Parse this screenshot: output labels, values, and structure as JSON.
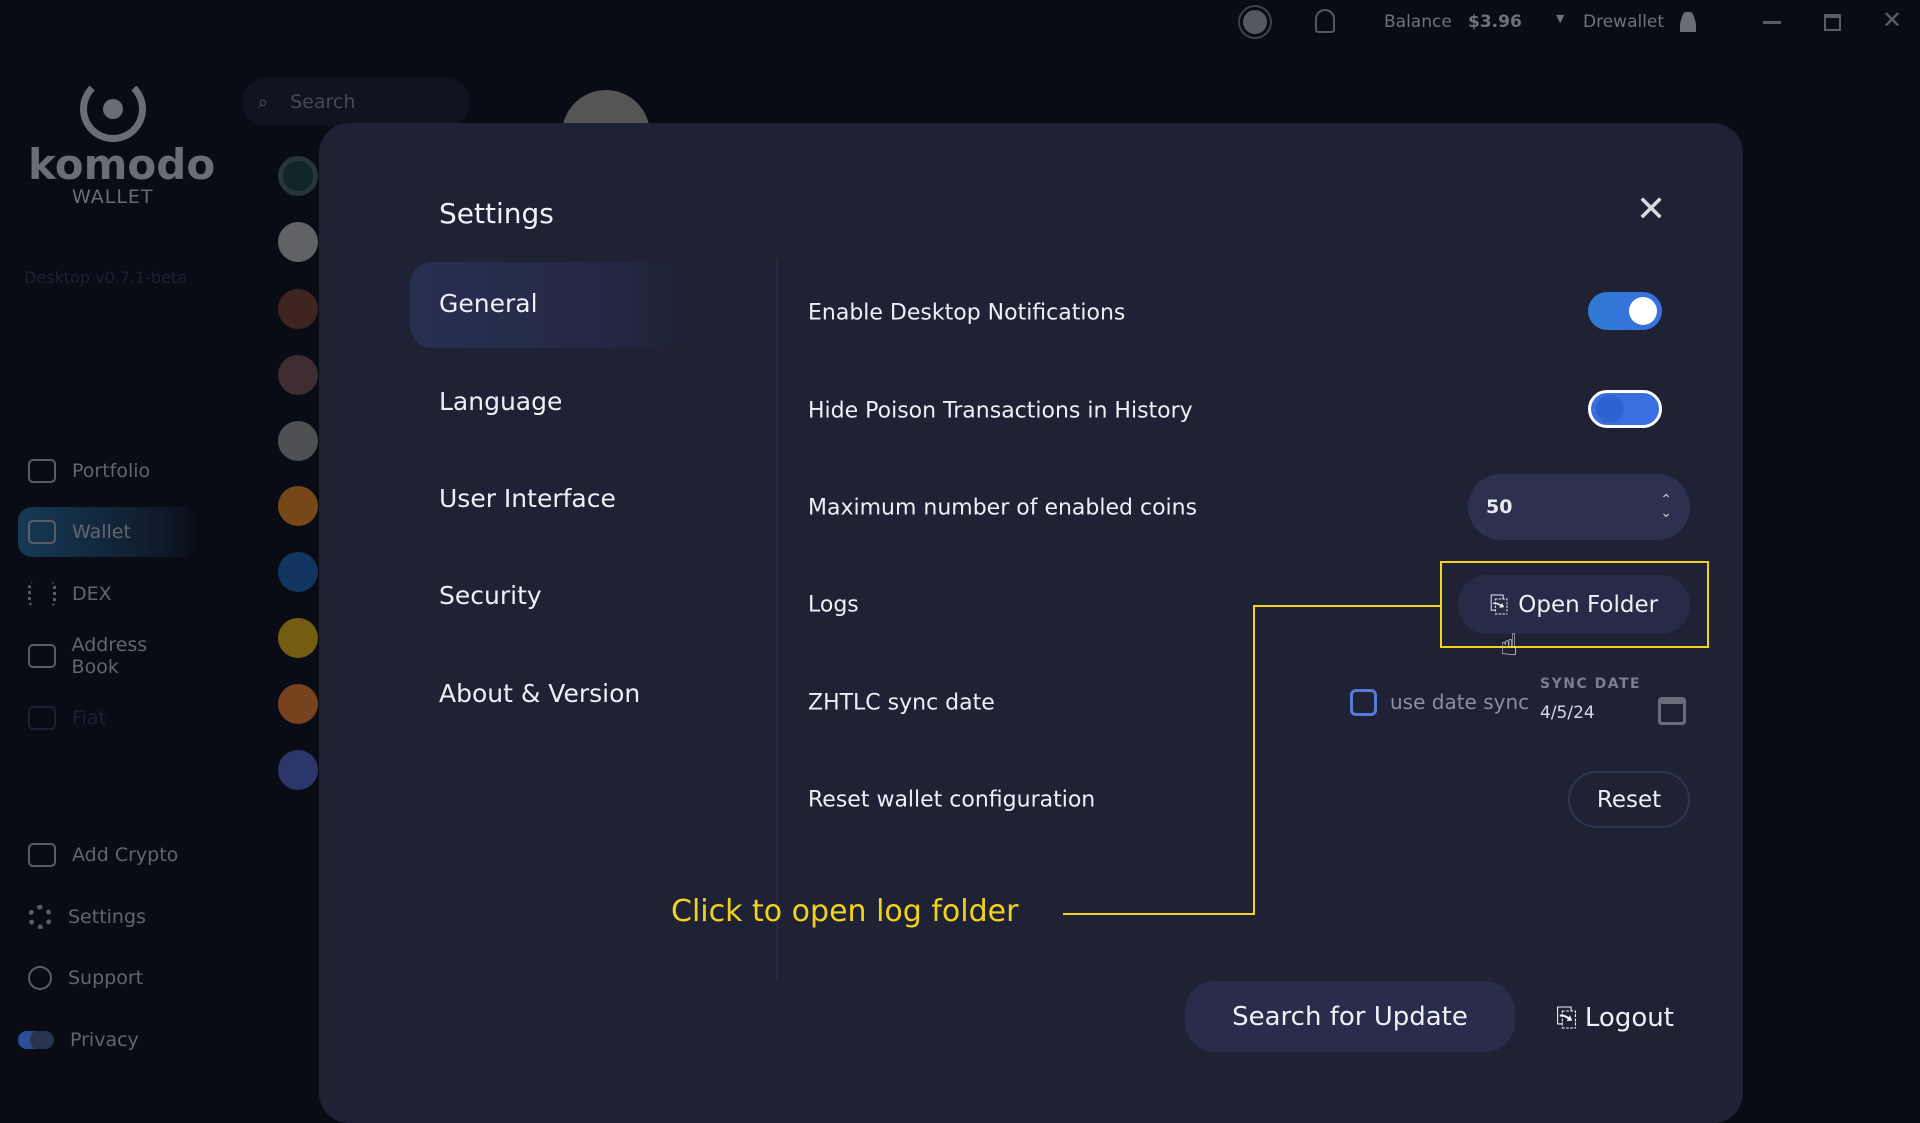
{
  "topbar": {
    "balance_label": "Balance",
    "balance_value": "$3.96",
    "account": "Drewallet",
    "icons": [
      "sun-icon",
      "bell-icon",
      "user-icon",
      "minimize-icon",
      "maximize-icon",
      "close-icon"
    ]
  },
  "sidebar": {
    "logo_text": "komodo",
    "logo_sub": "WALLET",
    "version": "Desktop v0.7.1-beta",
    "search_placeholder": "Search",
    "items": [
      {
        "label": "Portfolio"
      },
      {
        "label": "Wallet",
        "active": true
      },
      {
        "label": "DEX"
      },
      {
        "label": "Address Book"
      },
      {
        "label": "Fiat"
      }
    ],
    "bottom": [
      {
        "label": "Add Crypto"
      },
      {
        "label": "Settings"
      },
      {
        "label": "Support"
      },
      {
        "label": "Privacy"
      }
    ]
  },
  "coins": [
    "komodo",
    "panda",
    "avatar-1",
    "avatar-2",
    "litecoin",
    "bitcoin",
    "digibyte",
    "yellow-coin",
    "shiba",
    "ethereum"
  ],
  "settings": {
    "title": "Settings",
    "nav": [
      {
        "label": "General",
        "active": true
      },
      {
        "label": "Language"
      },
      {
        "label": "User Interface"
      },
      {
        "label": "Security"
      },
      {
        "label": "About & Version"
      }
    ],
    "rows": {
      "notifications": {
        "label": "Enable Desktop Notifications",
        "on": true
      },
      "poison": {
        "label": "Hide Poison Transactions in History",
        "on": true
      },
      "max_coins": {
        "label": "Maximum number of enabled coins",
        "value": "50"
      },
      "logs": {
        "label": "Logs",
        "button": "Open Folder"
      },
      "zhtlc": {
        "label": "ZHTLC sync date",
        "checkbox_label": "use date sync",
        "checked": false,
        "sync_date_label": "SYNC DATE",
        "sync_date": "4/5/24"
      },
      "reset": {
        "label": "Reset wallet configuration",
        "button": "Reset"
      }
    },
    "search_update": "Search for Update",
    "logout": "Logout"
  },
  "annotation": {
    "text": "Click to open log folder",
    "color": "#f2d21a"
  }
}
